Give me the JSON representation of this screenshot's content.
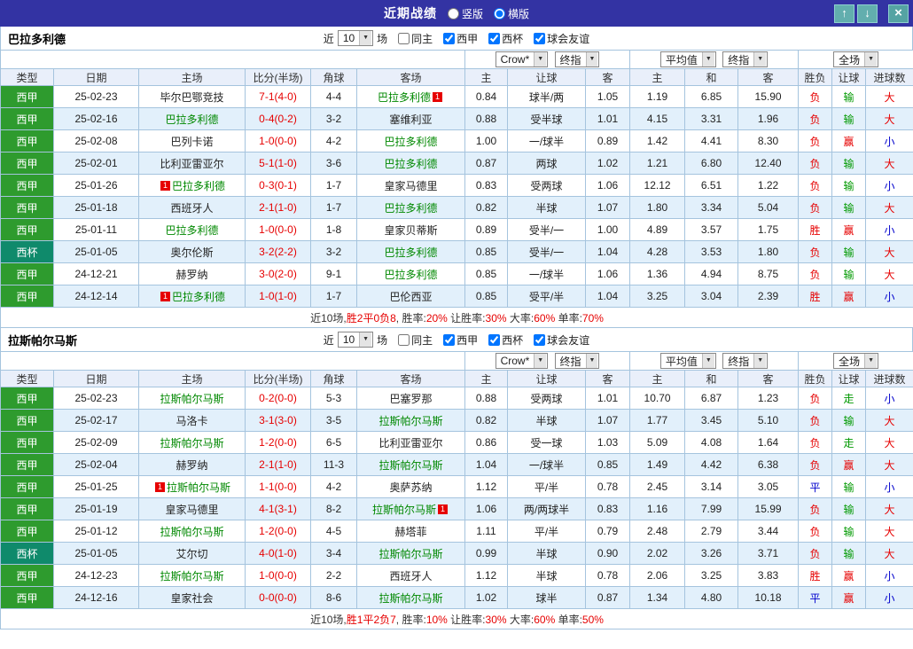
{
  "titlebar": {
    "title": "近期战绩",
    "radio_options": [
      {
        "label": "竖版",
        "selected": false
      },
      {
        "label": "横版",
        "selected": true
      }
    ],
    "buttons": {
      "up": "↑",
      "down": "↓",
      "close": "×"
    }
  },
  "controls": {
    "near_label": "近",
    "near_value": "10",
    "games_label": "场",
    "checkboxes": [
      {
        "label": "同主",
        "checked": false
      },
      {
        "label": "西甲",
        "checked": true
      },
      {
        "label": "西杯",
        "checked": true
      },
      {
        "label": "球会友谊",
        "checked": true
      }
    ],
    "selects": {
      "bookmaker": "Crow*",
      "asian_stage": "终指",
      "euro_source": "平均值",
      "euro_stage": "终指",
      "scope": "全场"
    }
  },
  "columns": [
    "类型",
    "日期",
    "主场",
    "比分(半场)",
    "角球",
    "客场",
    "主",
    "让球",
    "客",
    "主",
    "和",
    "客",
    "胜负",
    "让球",
    "进球数"
  ],
  "colors": {
    "liga_bg": "#2e9b2e",
    "cup_bg": "#0f8a6b",
    "focal_team": "#008800",
    "team_text": "#222222",
    "titlebar_bg": "#3333a3",
    "grid_line": "#a5c4de"
  },
  "palette": {
    "red": "#e60000",
    "green": "#009900",
    "blue": "#0000cc",
    "dark": "#333333"
  },
  "sections": [
    {
      "team": "巴拉多利德",
      "rows": [
        {
          "league": "西甲",
          "cup": false,
          "date": "25-02-23",
          "home": "毕尔巴鄂竞技",
          "home_focal": false,
          "home_badge": "",
          "score": "7-1(4-0)",
          "corners": "4-4",
          "away": "巴拉多利德",
          "away_focal": true,
          "away_badge": "1",
          "ah_home": "0.84",
          "ah_line": "球半/两",
          "ah_away": "1.05",
          "eu_home": "1.19",
          "eu_draw": "6.85",
          "eu_away": "15.90",
          "res": "负",
          "res_c": "red",
          "hc": "输",
          "hc_c": "green",
          "ou": "大",
          "ou_c": "red"
        },
        {
          "league": "西甲",
          "cup": false,
          "date": "25-02-16",
          "home": "巴拉多利德",
          "home_focal": true,
          "home_badge": "",
          "score": "0-4(0-2)",
          "corners": "3-2",
          "away": "塞维利亚",
          "away_focal": false,
          "away_badge": "",
          "ah_home": "0.88",
          "ah_line": "受半球",
          "ah_away": "1.01",
          "eu_home": "4.15",
          "eu_draw": "3.31",
          "eu_away": "1.96",
          "res": "负",
          "res_c": "red",
          "hc": "输",
          "hc_c": "green",
          "ou": "大",
          "ou_c": "red"
        },
        {
          "league": "西甲",
          "cup": false,
          "date": "25-02-08",
          "home": "巴列卡诺",
          "home_focal": false,
          "home_badge": "",
          "score": "1-0(0-0)",
          "corners": "4-2",
          "away": "巴拉多利德",
          "away_focal": true,
          "away_badge": "",
          "ah_home": "1.00",
          "ah_line": "一/球半",
          "ah_away": "0.89",
          "eu_home": "1.42",
          "eu_draw": "4.41",
          "eu_away": "8.30",
          "res": "负",
          "res_c": "red",
          "hc": "赢",
          "hc_c": "red",
          "ou": "小",
          "ou_c": "blue"
        },
        {
          "league": "西甲",
          "cup": false,
          "date": "25-02-01",
          "home": "比利亚雷亚尔",
          "home_focal": false,
          "home_badge": "",
          "score": "5-1(1-0)",
          "corners": "3-6",
          "away": "巴拉多利德",
          "away_focal": true,
          "away_badge": "",
          "ah_home": "0.87",
          "ah_line": "两球",
          "ah_away": "1.02",
          "eu_home": "1.21",
          "eu_draw": "6.80",
          "eu_away": "12.40",
          "res": "负",
          "res_c": "red",
          "hc": "输",
          "hc_c": "green",
          "ou": "大",
          "ou_c": "red"
        },
        {
          "league": "西甲",
          "cup": false,
          "date": "25-01-26",
          "home": "巴拉多利德",
          "home_focal": true,
          "home_badge": "1",
          "score": "0-3(0-1)",
          "corners": "1-7",
          "away": "皇家马德里",
          "away_focal": false,
          "away_badge": "",
          "ah_home": "0.83",
          "ah_line": "受两球",
          "ah_away": "1.06",
          "eu_home": "12.12",
          "eu_draw": "6.51",
          "eu_away": "1.22",
          "res": "负",
          "res_c": "red",
          "hc": "输",
          "hc_c": "green",
          "ou": "小",
          "ou_c": "blue"
        },
        {
          "league": "西甲",
          "cup": false,
          "date": "25-01-18",
          "home": "西班牙人",
          "home_focal": false,
          "home_badge": "",
          "score": "2-1(1-0)",
          "corners": "1-7",
          "away": "巴拉多利德",
          "away_focal": true,
          "away_badge": "",
          "ah_home": "0.82",
          "ah_line": "半球",
          "ah_away": "1.07",
          "eu_home": "1.80",
          "eu_draw": "3.34",
          "eu_away": "5.04",
          "res": "负",
          "res_c": "red",
          "hc": "输",
          "hc_c": "green",
          "ou": "大",
          "ou_c": "red"
        },
        {
          "league": "西甲",
          "cup": false,
          "date": "25-01-11",
          "home": "巴拉多利德",
          "home_focal": true,
          "home_badge": "",
          "score": "1-0(0-0)",
          "corners": "1-8",
          "away": "皇家贝蒂斯",
          "away_focal": false,
          "away_badge": "",
          "ah_home": "0.89",
          "ah_line": "受半/一",
          "ah_away": "1.00",
          "eu_home": "4.89",
          "eu_draw": "3.57",
          "eu_away": "1.75",
          "res": "胜",
          "res_c": "red",
          "hc": "赢",
          "hc_c": "red",
          "ou": "小",
          "ou_c": "blue"
        },
        {
          "league": "西杯",
          "cup": true,
          "date": "25-01-05",
          "home": "奥尔伦斯",
          "home_focal": false,
          "home_badge": "",
          "score": "3-2(2-2)",
          "corners": "3-2",
          "away": "巴拉多利德",
          "away_focal": true,
          "away_badge": "",
          "ah_home": "0.85",
          "ah_line": "受半/一",
          "ah_away": "1.04",
          "eu_home": "4.28",
          "eu_draw": "3.53",
          "eu_away": "1.80",
          "res": "负",
          "res_c": "red",
          "hc": "输",
          "hc_c": "green",
          "ou": "大",
          "ou_c": "red"
        },
        {
          "league": "西甲",
          "cup": false,
          "date": "24-12-21",
          "home": "赫罗纳",
          "home_focal": false,
          "home_badge": "",
          "score": "3-0(2-0)",
          "corners": "9-1",
          "away": "巴拉多利德",
          "away_focal": true,
          "away_badge": "",
          "ah_home": "0.85",
          "ah_line": "一/球半",
          "ah_away": "1.06",
          "eu_home": "1.36",
          "eu_draw": "4.94",
          "eu_away": "8.75",
          "res": "负",
          "res_c": "red",
          "hc": "输",
          "hc_c": "green",
          "ou": "大",
          "ou_c": "red"
        },
        {
          "league": "西甲",
          "cup": false,
          "date": "24-12-14",
          "home": "巴拉多利德",
          "home_focal": true,
          "home_badge": "1",
          "score": "1-0(1-0)",
          "corners": "1-7",
          "away": "巴伦西亚",
          "away_focal": false,
          "away_badge": "",
          "ah_home": "0.85",
          "ah_line": "受平/半",
          "ah_away": "1.04",
          "eu_home": "3.25",
          "eu_draw": "3.04",
          "eu_away": "2.39",
          "res": "胜",
          "res_c": "red",
          "hc": "赢",
          "hc_c": "red",
          "ou": "小",
          "ou_c": "blue"
        }
      ],
      "summary": [
        {
          "t": "近10场,",
          "c": "dark"
        },
        {
          "t": "胜2平0负8",
          "c": "red"
        },
        {
          "t": ", 胜率:",
          "c": "dark"
        },
        {
          "t": "20%",
          "c": "red"
        },
        {
          "t": " 让胜率:",
          "c": "dark"
        },
        {
          "t": "30%",
          "c": "red"
        },
        {
          "t": " 大率:",
          "c": "dark"
        },
        {
          "t": "60%",
          "c": "red"
        },
        {
          "t": " 单率:",
          "c": "dark"
        },
        {
          "t": "70%",
          "c": "red"
        }
      ]
    },
    {
      "team": "拉斯帕尔马斯",
      "rows": [
        {
          "league": "西甲",
          "cup": false,
          "date": "25-02-23",
          "home": "拉斯帕尔马斯",
          "home_focal": true,
          "home_badge": "",
          "score": "0-2(0-0)",
          "corners": "5-3",
          "away": "巴塞罗那",
          "away_focal": false,
          "away_badge": "",
          "ah_home": "0.88",
          "ah_line": "受两球",
          "ah_away": "1.01",
          "eu_home": "10.70",
          "eu_draw": "6.87",
          "eu_away": "1.23",
          "res": "负",
          "res_c": "red",
          "hc": "走",
          "hc_c": "green",
          "ou": "小",
          "ou_c": "blue"
        },
        {
          "league": "西甲",
          "cup": false,
          "date": "25-02-17",
          "home": "马洛卡",
          "home_focal": false,
          "home_badge": "",
          "score": "3-1(3-0)",
          "corners": "3-5",
          "away": "拉斯帕尔马斯",
          "away_focal": true,
          "away_badge": "",
          "ah_home": "0.82",
          "ah_line": "半球",
          "ah_away": "1.07",
          "eu_home": "1.77",
          "eu_draw": "3.45",
          "eu_away": "5.10",
          "res": "负",
          "res_c": "red",
          "hc": "输",
          "hc_c": "green",
          "ou": "大",
          "ou_c": "red"
        },
        {
          "league": "西甲",
          "cup": false,
          "date": "25-02-09",
          "home": "拉斯帕尔马斯",
          "home_focal": true,
          "home_badge": "",
          "score": "1-2(0-0)",
          "corners": "6-5",
          "away": "比利亚雷亚尔",
          "away_focal": false,
          "away_badge": "",
          "ah_home": "0.86",
          "ah_line": "受一球",
          "ah_away": "1.03",
          "eu_home": "5.09",
          "eu_draw": "4.08",
          "eu_away": "1.64",
          "res": "负",
          "res_c": "red",
          "hc": "走",
          "hc_c": "green",
          "ou": "大",
          "ou_c": "red"
        },
        {
          "league": "西甲",
          "cup": false,
          "date": "25-02-04",
          "home": "赫罗纳",
          "home_focal": false,
          "home_badge": "",
          "score": "2-1(1-0)",
          "corners": "11-3",
          "away": "拉斯帕尔马斯",
          "away_focal": true,
          "away_badge": "",
          "ah_home": "1.04",
          "ah_line": "一/球半",
          "ah_away": "0.85",
          "eu_home": "1.49",
          "eu_draw": "4.42",
          "eu_away": "6.38",
          "res": "负",
          "res_c": "red",
          "hc": "赢",
          "hc_c": "red",
          "ou": "大",
          "ou_c": "red"
        },
        {
          "league": "西甲",
          "cup": false,
          "date": "25-01-25",
          "home": "拉斯帕尔马斯",
          "home_focal": true,
          "home_badge": "1",
          "score": "1-1(0-0)",
          "corners": "4-2",
          "away": "奥萨苏纳",
          "away_focal": false,
          "away_badge": "",
          "ah_home": "1.12",
          "ah_line": "平/半",
          "ah_away": "0.78",
          "eu_home": "2.45",
          "eu_draw": "3.14",
          "eu_away": "3.05",
          "res": "平",
          "res_c": "blue",
          "hc": "输",
          "hc_c": "green",
          "ou": "小",
          "ou_c": "blue"
        },
        {
          "league": "西甲",
          "cup": false,
          "date": "25-01-19",
          "home": "皇家马德里",
          "home_focal": false,
          "home_badge": "",
          "score": "4-1(3-1)",
          "corners": "8-2",
          "away": "拉斯帕尔马斯",
          "away_focal": true,
          "away_badge": "1",
          "ah_home": "1.06",
          "ah_line": "两/两球半",
          "ah_away": "0.83",
          "eu_home": "1.16",
          "eu_draw": "7.99",
          "eu_away": "15.99",
          "res": "负",
          "res_c": "red",
          "hc": "输",
          "hc_c": "green",
          "ou": "大",
          "ou_c": "red"
        },
        {
          "league": "西甲",
          "cup": false,
          "date": "25-01-12",
          "home": "拉斯帕尔马斯",
          "home_focal": true,
          "home_badge": "",
          "score": "1-2(0-0)",
          "corners": "4-5",
          "away": "赫塔菲",
          "away_focal": false,
          "away_badge": "",
          "ah_home": "1.11",
          "ah_line": "平/半",
          "ah_away": "0.79",
          "eu_home": "2.48",
          "eu_draw": "2.79",
          "eu_away": "3.44",
          "res": "负",
          "res_c": "red",
          "hc": "输",
          "hc_c": "green",
          "ou": "大",
          "ou_c": "red"
        },
        {
          "league": "西杯",
          "cup": true,
          "date": "25-01-05",
          "home": "艾尔切",
          "home_focal": false,
          "home_badge": "",
          "score": "4-0(1-0)",
          "corners": "3-4",
          "away": "拉斯帕尔马斯",
          "away_focal": true,
          "away_badge": "",
          "ah_home": "0.99",
          "ah_line": "半球",
          "ah_away": "0.90",
          "eu_home": "2.02",
          "eu_draw": "3.26",
          "eu_away": "3.71",
          "res": "负",
          "res_c": "red",
          "hc": "输",
          "hc_c": "green",
          "ou": "大",
          "ou_c": "red"
        },
        {
          "league": "西甲",
          "cup": false,
          "date": "24-12-23",
          "home": "拉斯帕尔马斯",
          "home_focal": true,
          "home_badge": "",
          "score": "1-0(0-0)",
          "corners": "2-2",
          "away": "西班牙人",
          "away_focal": false,
          "away_badge": "",
          "ah_home": "1.12",
          "ah_line": "半球",
          "ah_away": "0.78",
          "eu_home": "2.06",
          "eu_draw": "3.25",
          "eu_away": "3.83",
          "res": "胜",
          "res_c": "red",
          "hc": "赢",
          "hc_c": "red",
          "ou": "小",
          "ou_c": "blue"
        },
        {
          "league": "西甲",
          "cup": false,
          "date": "24-12-16",
          "home": "皇家社会",
          "home_focal": false,
          "home_badge": "",
          "score": "0-0(0-0)",
          "corners": "8-6",
          "away": "拉斯帕尔马斯",
          "away_focal": true,
          "away_badge": "",
          "ah_home": "1.02",
          "ah_line": "球半",
          "ah_away": "0.87",
          "eu_home": "1.34",
          "eu_draw": "4.80",
          "eu_away": "10.18",
          "res": "平",
          "res_c": "blue",
          "hc": "赢",
          "hc_c": "red",
          "ou": "小",
          "ou_c": "blue"
        }
      ],
      "summary": [
        {
          "t": "近10场,",
          "c": "dark"
        },
        {
          "t": "胜1平2负7",
          "c": "red"
        },
        {
          "t": ", 胜率:",
          "c": "dark"
        },
        {
          "t": "10%",
          "c": "red"
        },
        {
          "t": " 让胜率:",
          "c": "dark"
        },
        {
          "t": "30%",
          "c": "red"
        },
        {
          "t": " 大率:",
          "c": "dark"
        },
        {
          "t": "60%",
          "c": "red"
        },
        {
          "t": " 单率:",
          "c": "dark"
        },
        {
          "t": "50%",
          "c": "red"
        }
      ]
    }
  ]
}
